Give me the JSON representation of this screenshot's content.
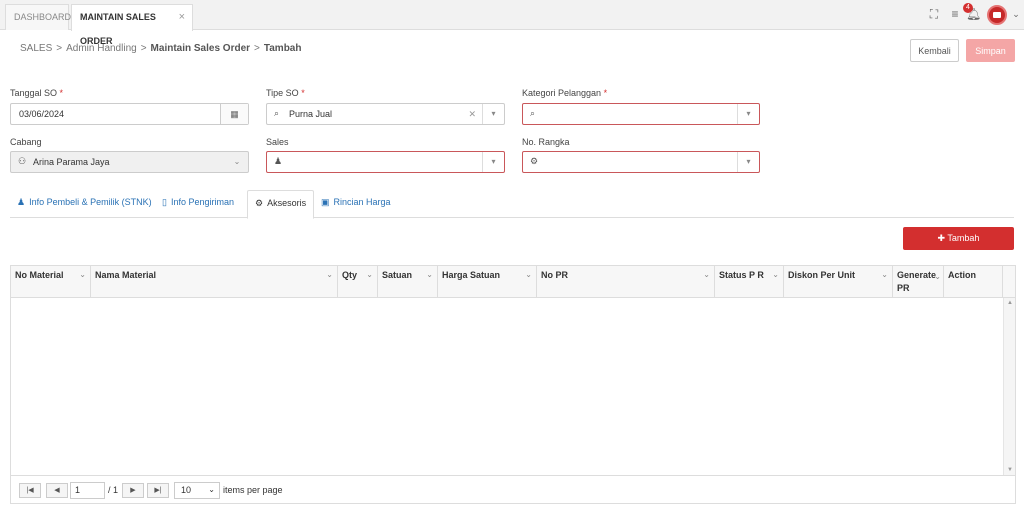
{
  "tabs": [
    {
      "label": "DASHBOARD"
    },
    {
      "label": "MAINTAIN SALES ORDER",
      "close": "×"
    }
  ],
  "header": {
    "notification_count": "4"
  },
  "breadcrumb": {
    "sep": ">",
    "items": [
      "SALES",
      "Admin Handling",
      "Maintain Sales Order",
      "Tambah"
    ]
  },
  "actions": {
    "kembali": "Kembali",
    "simpan": "Simpan"
  },
  "form": {
    "required_mark": "*",
    "tanggal_so": {
      "label": "Tanggal SO",
      "value": "03/06/2024"
    },
    "tipe_so": {
      "label": "Tipe SO",
      "value": "Purna Jual"
    },
    "kategori_pelanggan": {
      "label": "Kategori Pelanggan",
      "value": ""
    },
    "cabang": {
      "label": "Cabang",
      "value": "Arina Parama Jaya"
    },
    "sales": {
      "label": "Sales",
      "value": ""
    },
    "no_rangka": {
      "label": "No. Rangka",
      "value": ""
    }
  },
  "inner_tabs": [
    {
      "label": "Info Pembeli & Pemilik (STNK)"
    },
    {
      "label": "Info Pengiriman"
    },
    {
      "label": "Aksesoris"
    },
    {
      "label": "Rincian Harga"
    }
  ],
  "grid": {
    "add_label": "Tambah",
    "columns": [
      "No Material",
      "Nama Material",
      "Qty",
      "Satuan",
      "Harga Satuan",
      "No PR",
      "Status P R",
      "Diskon Per Unit",
      "Generate PR",
      "Action"
    ]
  },
  "pager": {
    "page": "1",
    "of": "/ 1",
    "page_size": "10",
    "items_per_page": "items per page"
  },
  "colors": {
    "primary": "#d32f2f",
    "link": "#2a72b5",
    "error_border": "#c9575a"
  }
}
